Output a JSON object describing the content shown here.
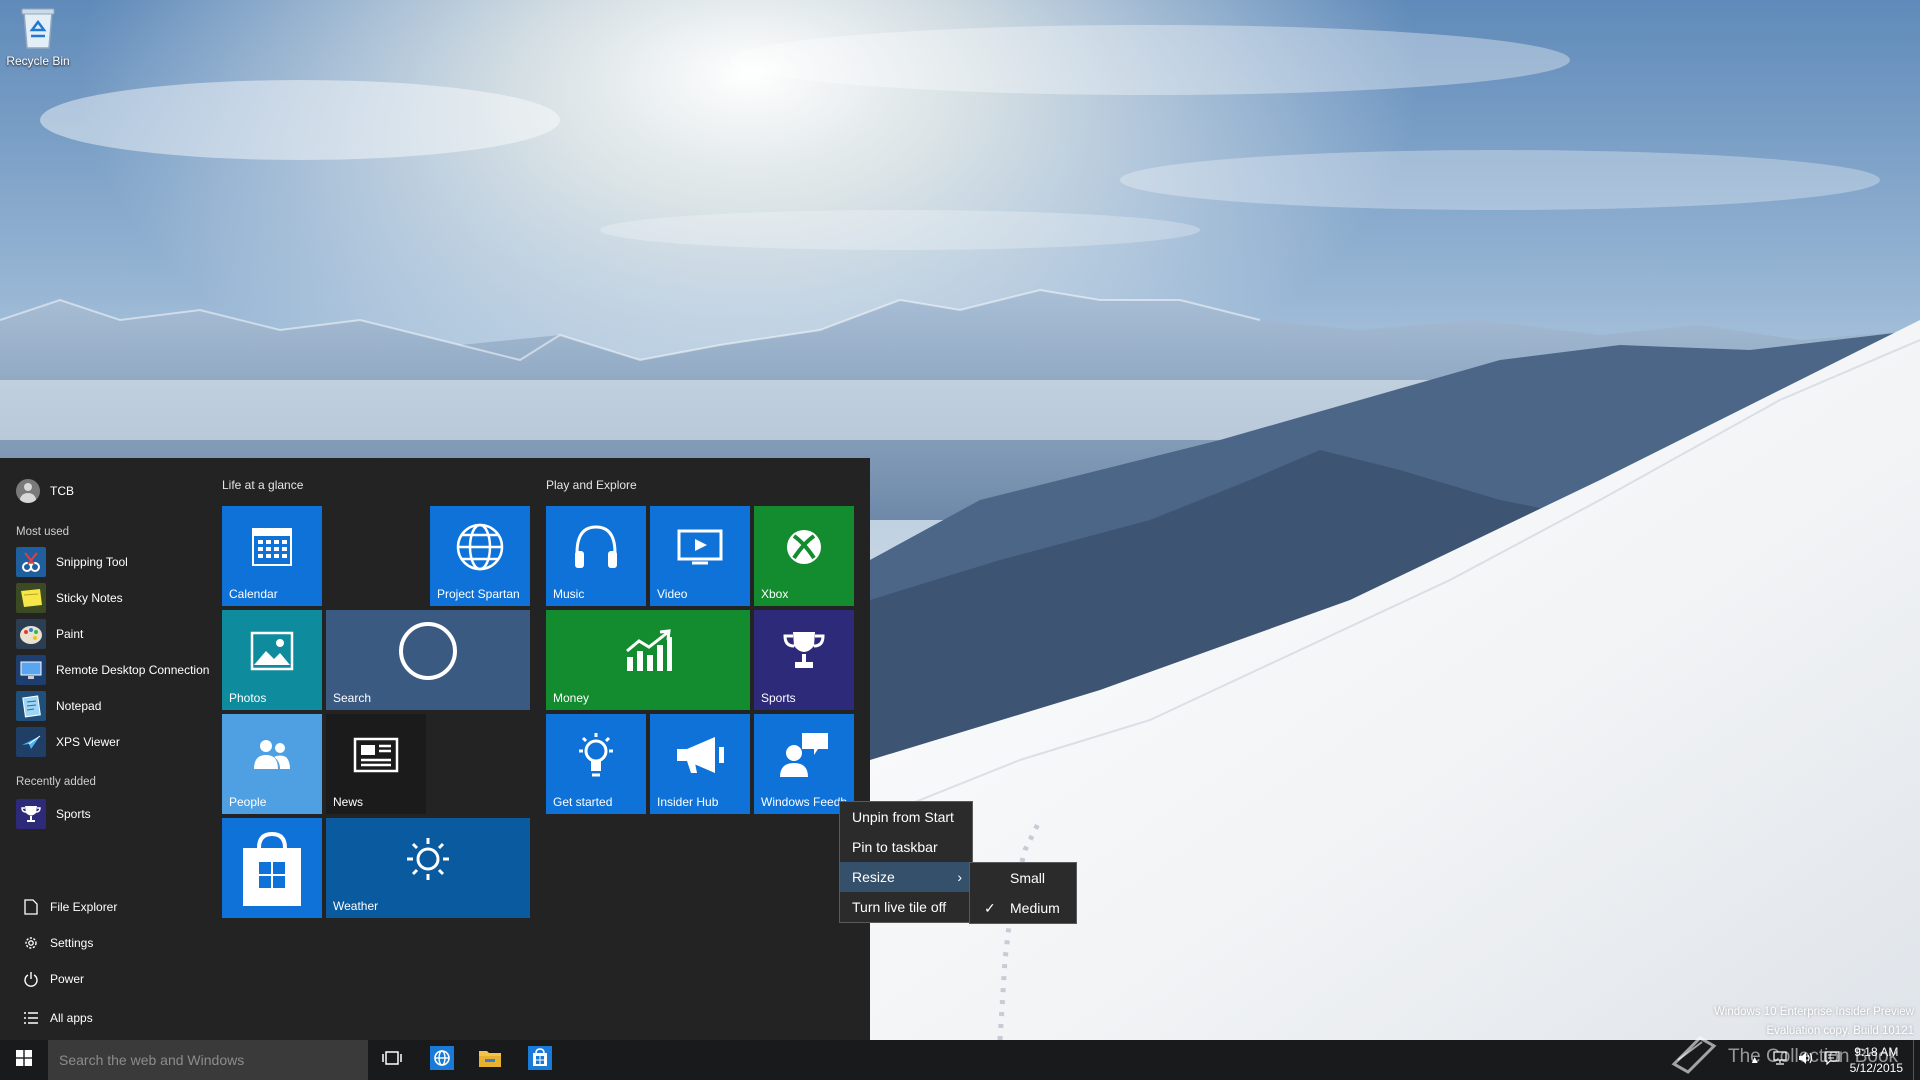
{
  "desktop": {
    "recycle_bin_label": "Recycle Bin"
  },
  "start_menu": {
    "user_name": "TCB",
    "most_used_header": "Most used",
    "most_used": [
      {
        "label": "Snipping Tool",
        "icon": "scissors-icon"
      },
      {
        "label": "Sticky Notes",
        "icon": "sticky-note-icon"
      },
      {
        "label": "Paint",
        "icon": "palette-icon"
      },
      {
        "label": "Remote Desktop Connection",
        "icon": "monitor-icon"
      },
      {
        "label": "Notepad",
        "icon": "notepad-icon"
      },
      {
        "label": "XPS Viewer",
        "icon": "document-plane-icon"
      }
    ],
    "recently_added_header": "Recently added",
    "recently_added": [
      {
        "label": "Sports",
        "icon": "trophy-icon"
      }
    ],
    "system_items": [
      {
        "label": "File Explorer",
        "icon": "document-icon"
      },
      {
        "label": "Settings",
        "icon": "gear-icon"
      },
      {
        "label": "Power",
        "icon": "power-icon"
      },
      {
        "label": "All apps",
        "icon": "list-icon"
      }
    ],
    "groups": {
      "life": "Life at a glance",
      "play": "Play and Explore"
    },
    "tiles": {
      "calendar": "Calendar",
      "project_spartan": "Project Spartan",
      "photos": "Photos",
      "search": "Search",
      "people": "People",
      "news": "News",
      "store": "",
      "weather": "Weather",
      "music": "Music",
      "video": "Video",
      "xbox": "Xbox",
      "money": "Money",
      "sports": "Sports",
      "get_started": "Get started",
      "insider_hub": "Insider Hub",
      "windows_feedback": "Windows Feedb"
    }
  },
  "context_menu": {
    "items": [
      "Unpin from Start",
      "Pin to taskbar",
      "Resize",
      "Turn live tile off"
    ],
    "resize_submenu": [
      "Small",
      "Medium"
    ],
    "selected_size": "Medium",
    "arrow": "›",
    "check": "✓"
  },
  "watermark": {
    "line1": "Windows 10 Enterprise Insider Preview",
    "line2": "Evaluation copy. Build 10121",
    "brand": "The Collection Book"
  },
  "taskbar": {
    "search_placeholder": "Search the web and Windows",
    "time": "9:18 AM",
    "date": "5/12/2015"
  },
  "colors": {
    "start_bg": "#232323",
    "tile_blue": "#0e72d8",
    "tile_green": "#128c2f",
    "tile_teal": "#0f8b9e",
    "search_tile": "#3b5a82",
    "people_tile": "#4fa0e2",
    "news_tile": "#1b1b1b",
    "weather_tile": "#0a5aa0",
    "sports_tile": "#2d2a7a"
  }
}
